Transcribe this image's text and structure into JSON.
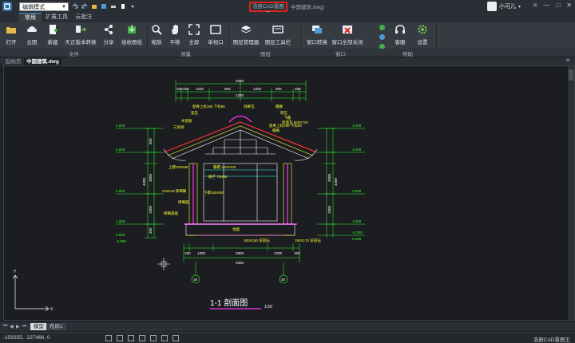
{
  "window": {
    "mode_value": "编辑模式",
    "app_title": "浩辰CAD看图王",
    "file_title": "中国建筑.dwg]",
    "username": "小可儿"
  },
  "tabs": [
    "常用",
    "扩展工具",
    "云批注"
  ],
  "ribbon": {
    "buttons": [
      "打开",
      "云图",
      "新建",
      "天正版本转换",
      "分享",
      "接收图纸",
      "缩放",
      "平移",
      "全屏",
      "单视口",
      "图层管理器",
      "图层工具栏",
      "窗口转换",
      "窗口全部关闭",
      "客服",
      "设置"
    ],
    "groups": [
      "文件",
      "测量",
      "图层",
      "窗口",
      "帮助"
    ]
  },
  "documents": {
    "tabs": [
      "起始页",
      "中国建筑.dwg"
    ]
  },
  "drawing": {
    "title": "1-1   剖面图",
    "scale": "1:50",
    "labels": [
      "屋脊上标180 下标90",
      "竖瓦",
      "戗脊瓦",
      "檐椽",
      "飞檐",
      "筒瓦",
      "屋面瓦 600X720",
      "檐椽",
      "屋脊上标180 下标90",
      "三架梁",
      "木望板",
      "上檩100X80",
      "下檩100X80",
      "椽子 70X90",
      "檐檩 120X100",
      "210X40 砖细脚",
      "砖细面",
      "砖细基础",
      "地面",
      "300X150 花岗石",
      "150X170 花岗石"
    ],
    "dims_top": [
      "2000",
      "250",
      "250",
      "1200",
      "900",
      "1200",
      "900",
      "1200",
      "250"
    ],
    "dims_bottom": [
      "150",
      "1200",
      "2800",
      "1200",
      "150",
      "4000"
    ],
    "levels": [
      "4.000",
      "3.600",
      "2.900",
      "1.800",
      "0.000",
      "-0.600",
      "4.000",
      "3.600",
      "2.900",
      "1.800",
      "-0.300",
      "0.300"
    ],
    "axes": [
      "16",
      "20"
    ],
    "vdims": [
      "4300",
      "3000",
      "1800",
      "400",
      "600",
      "4300",
      "3000",
      "1800"
    ]
  },
  "layout_tabs": [
    "模型",
    "布局1"
  ],
  "status": {
    "coords": "-159255, -227466, 0",
    "right_text": "浩辰CAD看图王"
  },
  "colors": {
    "accent_blue": "#4a9bd8",
    "highlight_red": "#e0201c",
    "cad_green": "#33ff33",
    "cad_yellow": "#ffff33",
    "cad_magenta": "#ff33ff",
    "cad_cyan": "#33ffff",
    "cad_red": "#ff3333"
  }
}
